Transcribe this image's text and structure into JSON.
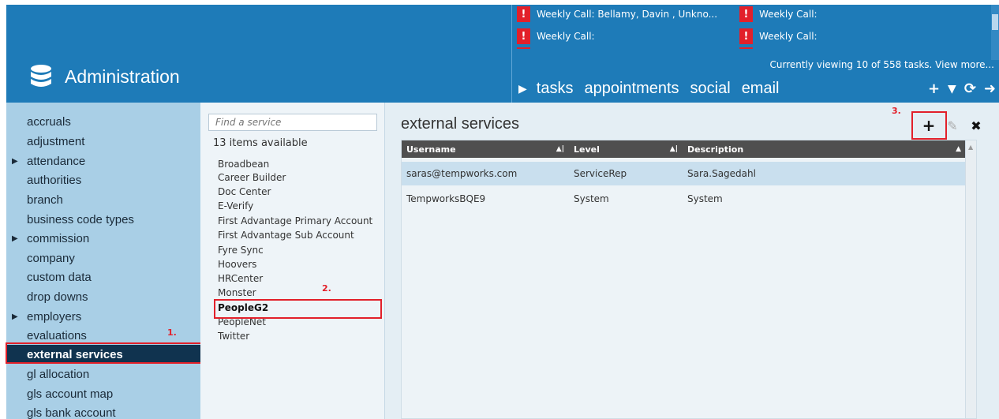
{
  "header": {
    "title": "Administration",
    "tasks": [
      {
        "label": "Weekly Call: Bellamy, Davin , Unkno..."
      },
      {
        "label": "Weekly Call:"
      },
      {
        "label": "Weekly Call:"
      },
      {
        "label": "Weekly Call:"
      }
    ],
    "alert_glyph": "!",
    "viewing": "Currently viewing 10 of 558 tasks. View more...",
    "tabs": [
      "tasks",
      "appointments",
      "social",
      "email"
    ],
    "tools": {
      "add": "+",
      "filter": "▼",
      "refresh": "⟳",
      "go": "➜"
    }
  },
  "sidebar": {
    "items": [
      {
        "label": "accruals",
        "expandable": false
      },
      {
        "label": "adjustment",
        "expandable": false
      },
      {
        "label": "attendance",
        "expandable": true
      },
      {
        "label": "authorities",
        "expandable": false
      },
      {
        "label": "branch",
        "expandable": false
      },
      {
        "label": "business code types",
        "expandable": false
      },
      {
        "label": "commission",
        "expandable": true
      },
      {
        "label": "company",
        "expandable": false
      },
      {
        "label": "custom data",
        "expandable": false
      },
      {
        "label": "drop downs",
        "expandable": false
      },
      {
        "label": "employers",
        "expandable": true
      },
      {
        "label": "evaluations",
        "expandable": false
      },
      {
        "label": "external services",
        "expandable": false,
        "selected": true
      },
      {
        "label": "gl allocation",
        "expandable": false
      },
      {
        "label": "gls account map",
        "expandable": false
      },
      {
        "label": "gls bank account",
        "expandable": false
      }
    ]
  },
  "services": {
    "search_placeholder": "Find a service",
    "count_label": "13 items available",
    "items": [
      "Broadbean",
      "Career Builder",
      "Doc Center",
      "E-Verify",
      "First Advantage Primary Account",
      "First Advantage Sub Account",
      "Fyre Sync",
      "Hoovers",
      "HRCenter",
      "Monster",
      "PeopleG2",
      "PeopleNet",
      "Twitter"
    ],
    "selected": "PeopleG2"
  },
  "main": {
    "title": "external services",
    "columns": [
      "Username",
      "Level",
      "Description"
    ],
    "rows": [
      {
        "username": "saras@tempworks.com",
        "level": "ServiceRep",
        "description": "Sara.Sagedahl"
      },
      {
        "username": "TempworksBQE9",
        "level": "System",
        "description": "System"
      }
    ],
    "tools": {
      "add": "+",
      "edit": "✎",
      "delete": "✖"
    }
  },
  "steps": [
    "1.",
    "2.",
    "3."
  ],
  "colors": {
    "header": "#1e7bb8",
    "sidebar": "#a9cfe6",
    "selected": "#10334f",
    "highlight": "#e2202a"
  }
}
